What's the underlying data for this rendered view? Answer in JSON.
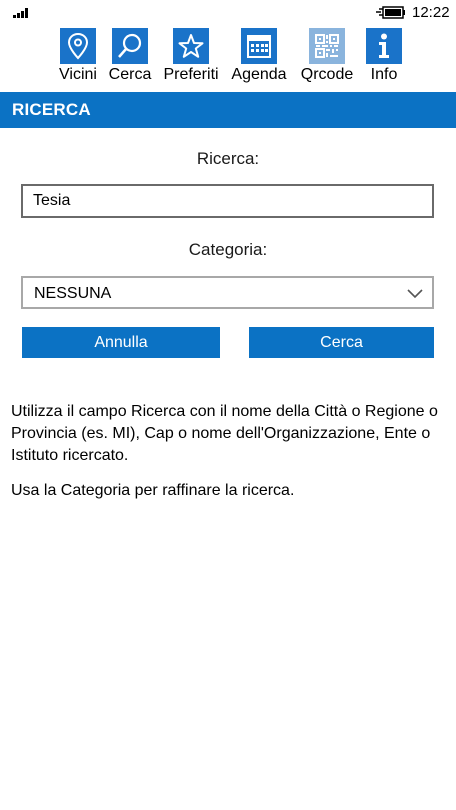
{
  "status_bar": {
    "time": "12:22"
  },
  "nav": {
    "items": [
      {
        "label": "Vicini",
        "icon": "map-pin-icon"
      },
      {
        "label": "Cerca",
        "icon": "search-icon"
      },
      {
        "label": "Preferiti",
        "icon": "star-icon"
      },
      {
        "label": "Agenda",
        "icon": "calendar-icon"
      },
      {
        "label": "Qrcode",
        "icon": "qrcode-icon"
      },
      {
        "label": "Info",
        "icon": "info-icon"
      }
    ]
  },
  "header": {
    "title": "RICERCA"
  },
  "form": {
    "search_label": "Ricerca:",
    "search_value": "Tesia",
    "category_label": "Categoria:",
    "category_value": "NESSUNA",
    "cancel_label": "Annulla",
    "submit_label": "Cerca"
  },
  "help": {
    "paragraph1": "Utilizza il campo Ricerca con il nome della Città o Regione o Provincia (es. MI), Cap o nome dell'Organizzazione, Ente o Istituto ricercato.",
    "paragraph2": "Usa la Categoria per raffinare la ricerca."
  },
  "colors": {
    "accent": "#0b72c4",
    "qrcode_tile": "#8ab4dd"
  }
}
